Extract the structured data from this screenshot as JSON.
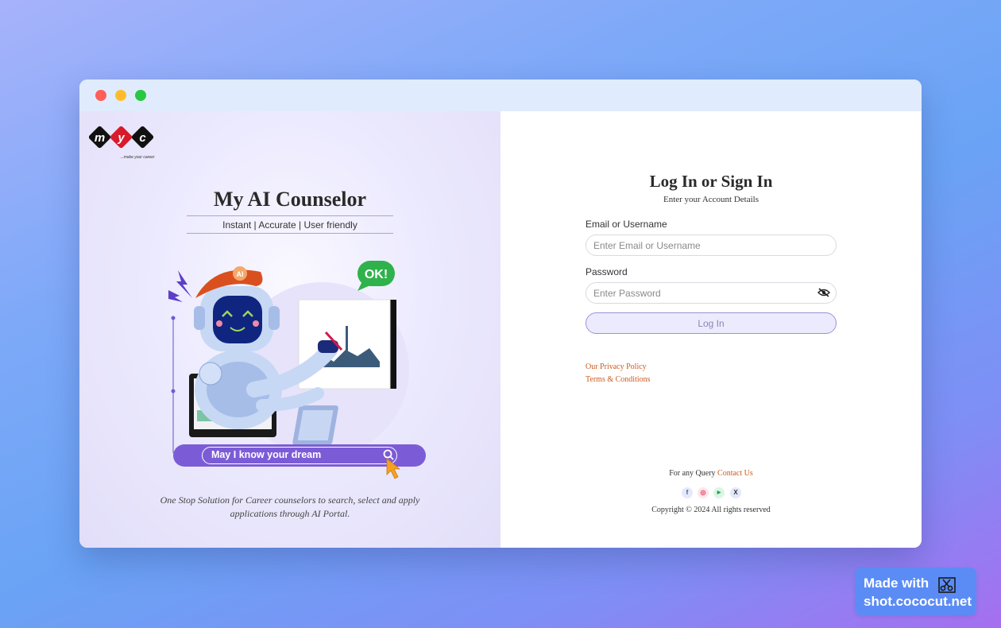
{
  "brand": {
    "logo_letters": [
      "m",
      "y",
      "c"
    ],
    "logo_tagline": "...make your career",
    "title": "My AI Counselor",
    "tagline": "Instant | Accurate | User friendly",
    "hero_badge": "OK!",
    "hero_hat_label": "AI",
    "hero_search_text": "May I know your dream",
    "description_line1": "One Stop Solution for Career counselors to search, select and apply",
    "description_line2": "applications through AI Portal."
  },
  "form": {
    "title": "Log In or Sign In",
    "subtitle": "Enter your Account Details",
    "email_label": "Email or Username",
    "email_placeholder": "Enter Email or Username",
    "email_value": "",
    "password_label": "Password",
    "password_placeholder": "Enter Password",
    "password_value": "",
    "password_toggle_icon": "eye-slash-icon",
    "submit_label": "Log In"
  },
  "links": {
    "privacy": "Our Privacy Policy",
    "terms": "Terms & Conditions"
  },
  "footer": {
    "query_prefix": "For any Query",
    "contact_label": "Contact Us",
    "copyright": "Copyright © 2024 All rights reserved",
    "socials": [
      {
        "name": "facebook-icon",
        "glyph": "f",
        "color": "#3b5998",
        "bg": "#e6e9fb"
      },
      {
        "name": "instagram-icon",
        "glyph": "◎",
        "color": "#e4405f",
        "bg": "#fde6ea"
      },
      {
        "name": "youtube-icon",
        "glyph": "▶",
        "color": "#16a34a",
        "bg": "#ddf5e5"
      },
      {
        "name": "x-icon",
        "glyph": "X",
        "color": "#333333",
        "bg": "#e3e8fb"
      }
    ]
  },
  "watermark": {
    "line1": "Made with",
    "line2": "shot.cococut.net"
  },
  "colors": {
    "accent_link": "#cc5a1e",
    "button_bg": "#ecebfd",
    "button_border": "#9a92d6",
    "hero_purple": "#7c5cd6"
  }
}
